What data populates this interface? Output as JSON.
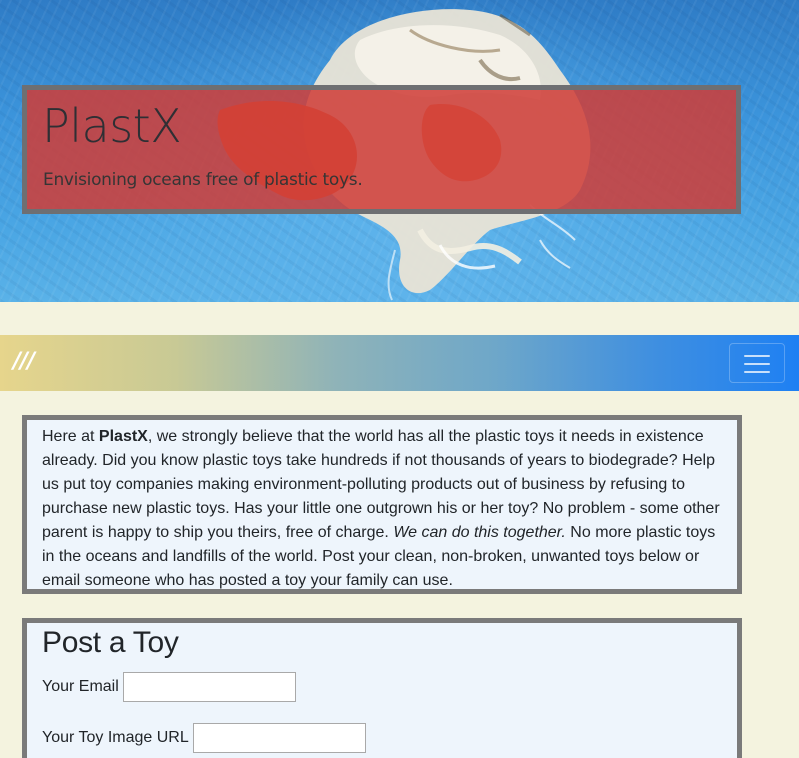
{
  "hero": {
    "title": "PlastX",
    "tagline": "Envisioning oceans free of plastic toys."
  },
  "navbar": {
    "brand": "///",
    "toggler_icon": "hamburger-menu-icon"
  },
  "intro": {
    "part1": "Here at ",
    "brand_bold": "PlastX",
    "part2": ", we strongly believe that the world has all the plastic toys it needs in existence already. Did you know plastic toys take hundreds if not thousands of years to biodegrade? Help us put toy companies making environment-polluting products out of business by refusing to purchase new plastic toys. Has your little one outgrown his or her toy? No problem - some other parent is happy to ship you theirs, free of charge. ",
    "emphasis": "We can do this together.",
    "part3": " No more plastic toys in the oceans and landfills of the world. Post your clean, non-broken, unwanted toys below or email someone who has posted a toy your family can use."
  },
  "post_form": {
    "heading": "Post a Toy",
    "email_label": "Your Email",
    "email_value": "",
    "image_label": "Your Toy Image URL",
    "image_value": ""
  },
  "colors": {
    "page_background": "#f4f3df",
    "title_box": "#cf3c37",
    "card_background": "#eef5fc",
    "card_border": "#7a7a7a",
    "navbar_start": "#e6d58c",
    "navbar_end": "#1e80f3"
  }
}
